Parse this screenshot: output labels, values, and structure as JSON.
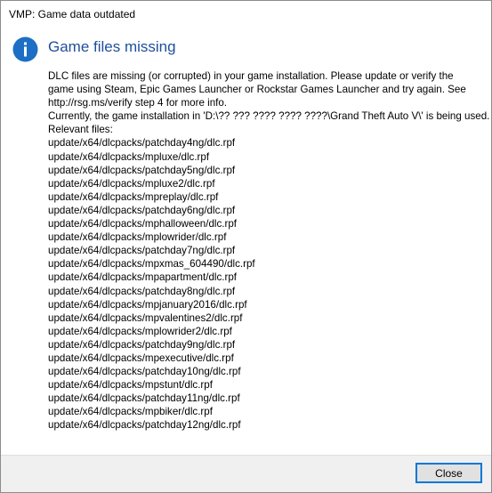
{
  "window": {
    "title": "VMP: Game data outdated"
  },
  "dialog": {
    "icon": "info-icon",
    "heading": "Game files missing",
    "message_lines": [
      "DLC files are missing (or corrupted) in your game installation. Please update or verify the",
      "game using Steam, Epic Games Launcher or Rockstar Games Launcher and try again. See",
      "http://rsg.ms/verify step 4 for more info.",
      "Currently, the game installation in 'D:\\?? ??? ???? ???? ????\\Grand Theft Auto V\\' is being used.",
      "Relevant files:"
    ],
    "files": [
      "update/x64/dlcpacks/patchday4ng/dlc.rpf",
      "update/x64/dlcpacks/mpluxe/dlc.rpf",
      "update/x64/dlcpacks/patchday5ng/dlc.rpf",
      "update/x64/dlcpacks/mpluxe2/dlc.rpf",
      "update/x64/dlcpacks/mpreplay/dlc.rpf",
      "update/x64/dlcpacks/patchday6ng/dlc.rpf",
      "update/x64/dlcpacks/mphalloween/dlc.rpf",
      "update/x64/dlcpacks/mplowrider/dlc.rpf",
      "update/x64/dlcpacks/patchday7ng/dlc.rpf",
      "update/x64/dlcpacks/mpxmas_604490/dlc.rpf",
      "update/x64/dlcpacks/mpapartment/dlc.rpf",
      "update/x64/dlcpacks/patchday8ng/dlc.rpf",
      "update/x64/dlcpacks/mpjanuary2016/dlc.rpf",
      "update/x64/dlcpacks/mpvalentines2/dlc.rpf",
      "update/x64/dlcpacks/mplowrider2/dlc.rpf",
      "update/x64/dlcpacks/patchday9ng/dlc.rpf",
      "update/x64/dlcpacks/mpexecutive/dlc.rpf",
      "update/x64/dlcpacks/patchday10ng/dlc.rpf",
      "update/x64/dlcpacks/mpstunt/dlc.rpf",
      "update/x64/dlcpacks/patchday11ng/dlc.rpf",
      "update/x64/dlcpacks/mpbiker/dlc.rpf",
      "update/x64/dlcpacks/patchday12ng/dlc.rpf"
    ]
  },
  "footer": {
    "close_label": "Close"
  },
  "colors": {
    "heading": "#1f4f9c",
    "icon_fill": "#1c6fc4",
    "button_border": "#0078d7",
    "footer_bg": "#f0f0f0"
  }
}
